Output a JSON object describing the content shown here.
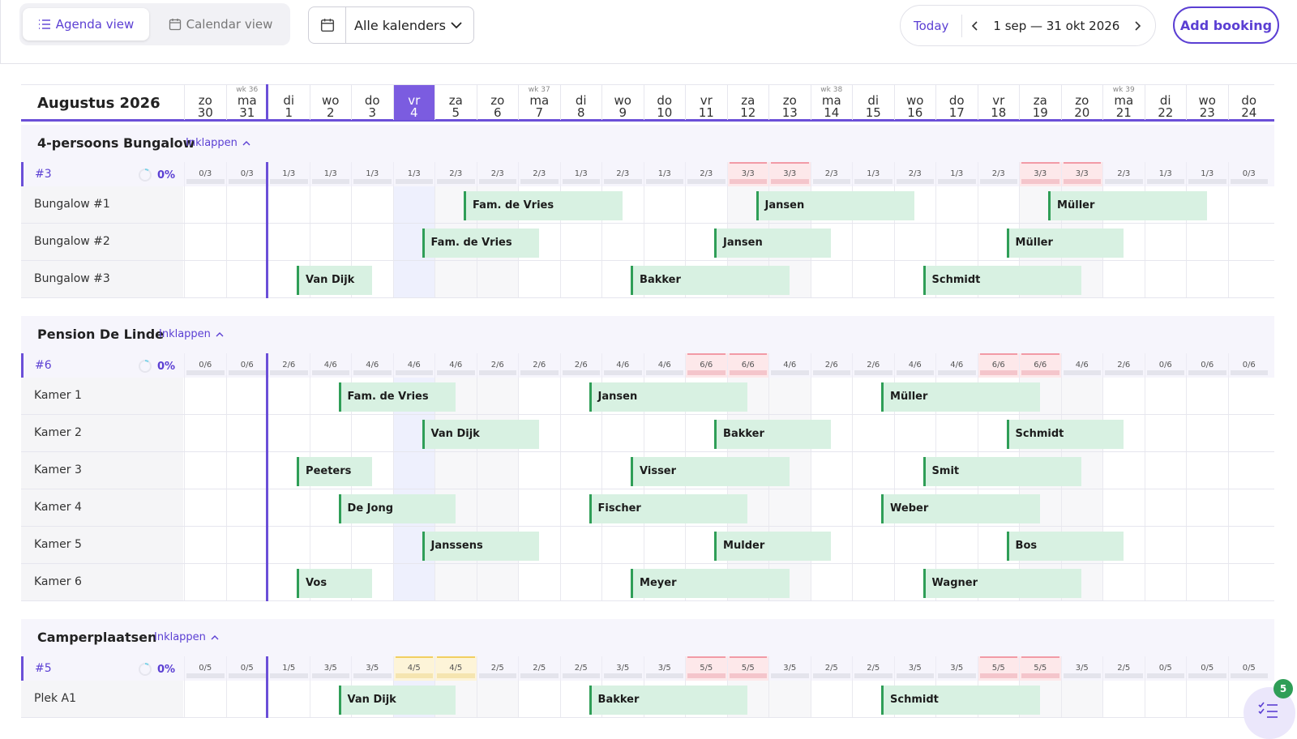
{
  "toolbar": {
    "agenda_label": "Agenda view",
    "calendar_label": "Calendar view",
    "calendar_select": "Alle kalenders",
    "today_label": "Today",
    "date_range": "1 sep — 31 okt 2026",
    "add_booking_label": "Add booking"
  },
  "header": {
    "month": "Augustus 2026",
    "today_index": 6,
    "days": [
      {
        "wk": "",
        "dn": "zo",
        "dd": "30"
      },
      {
        "wk": "wk 36",
        "dn": "ma",
        "dd": "31"
      },
      {
        "wk": "",
        "dn": "di",
        "dd": "1"
      },
      {
        "wk": "",
        "dn": "wo",
        "dd": "2"
      },
      {
        "wk": "",
        "dn": "do",
        "dd": "3"
      },
      {
        "wk": "",
        "dn": "vr",
        "dd": "4"
      },
      {
        "wk": "",
        "dn": "za",
        "dd": "5"
      },
      {
        "wk": "",
        "dn": "zo",
        "dd": "6"
      },
      {
        "wk": "wk 37",
        "dn": "ma",
        "dd": "7"
      },
      {
        "wk": "",
        "dn": "di",
        "dd": "8"
      },
      {
        "wk": "",
        "dn": "wo",
        "dd": "9"
      },
      {
        "wk": "",
        "dn": "do",
        "dd": "10"
      },
      {
        "wk": "",
        "dn": "vr",
        "dd": "11"
      },
      {
        "wk": "",
        "dn": "za",
        "dd": "12"
      },
      {
        "wk": "",
        "dn": "zo",
        "dd": "13"
      },
      {
        "wk": "wk 38",
        "dn": "ma",
        "dd": "14"
      },
      {
        "wk": "",
        "dn": "di",
        "dd": "15"
      },
      {
        "wk": "",
        "dn": "wo",
        "dd": "16"
      },
      {
        "wk": "",
        "dn": "do",
        "dd": "17"
      },
      {
        "wk": "",
        "dn": "vr",
        "dd": "18"
      },
      {
        "wk": "",
        "dn": "za",
        "dd": "19"
      },
      {
        "wk": "",
        "dn": "zo",
        "dd": "20"
      },
      {
        "wk": "wk 39",
        "dn": "ma",
        "dd": "21"
      },
      {
        "wk": "",
        "dn": "di",
        "dd": "22"
      },
      {
        "wk": "",
        "dn": "wo",
        "dd": "23"
      },
      {
        "wk": "",
        "dn": "do",
        "dd": "24"
      }
    ]
  },
  "collapse_label": "Inklappen",
  "sections": [
    {
      "title": "4-persoons Bungalow",
      "occ_id": "#3",
      "occ_pct": "0%",
      "occupancy": [
        "0/3",
        "0/3",
        "1/3",
        "1/3",
        "1/3",
        "1/3",
        "2/3",
        "2/3",
        "2/3",
        "1/3",
        "2/3",
        "1/3",
        "2/3",
        "3/3",
        "3/3",
        "2/3",
        "1/3",
        "2/3",
        "1/3",
        "2/3",
        "3/3",
        "3/3",
        "2/3",
        "1/3",
        "1/3",
        "0/3"
      ],
      "occ_status": [
        "",
        "",
        "",
        "",
        "",
        "",
        "",
        "",
        "",
        "",
        "",
        "",
        "",
        "full",
        "full",
        "",
        "",
        "",
        "",
        "",
        "full",
        "full",
        "",
        "",
        "",
        ""
      ],
      "units": [
        {
          "name": "Bungalow #1",
          "bookings": [
            {
              "label": "Fam. de Vries",
              "start": 6.7,
              "len": 3.8
            },
            {
              "label": "Jansen",
              "start": 13.7,
              "len": 3.8
            },
            {
              "label": "Müller",
              "start": 20.7,
              "len": 3.8
            }
          ]
        },
        {
          "name": "Bungalow #2",
          "bookings": [
            {
              "label": "Fam. de Vries",
              "start": 5.7,
              "len": 2.8
            },
            {
              "label": "Jansen",
              "start": 12.7,
              "len": 2.8
            },
            {
              "label": "Müller",
              "start": 19.7,
              "len": 2.8
            }
          ]
        },
        {
          "name": "Bungalow #3",
          "bookings": [
            {
              "label": "Van Dijk",
              "start": 2.7,
              "len": 1.8
            },
            {
              "label": "Bakker",
              "start": 10.7,
              "len": 3.8
            },
            {
              "label": "Schmidt",
              "start": 17.7,
              "len": 3.8
            }
          ]
        }
      ]
    },
    {
      "title": "Pension De Linde",
      "occ_id": "#6",
      "occ_pct": "0%",
      "occupancy": [
        "0/6",
        "0/6",
        "2/6",
        "4/6",
        "4/6",
        "4/6",
        "4/6",
        "2/6",
        "2/6",
        "2/6",
        "4/6",
        "4/6",
        "6/6",
        "6/6",
        "4/6",
        "2/6",
        "2/6",
        "4/6",
        "4/6",
        "6/6",
        "6/6",
        "4/6",
        "2/6",
        "0/6",
        "0/6",
        "0/6"
      ],
      "occ_status": [
        "",
        "",
        "",
        "",
        "",
        "",
        "",
        "",
        "",
        "",
        "",
        "",
        "full",
        "full",
        "",
        "",
        "",
        "",
        "",
        "full",
        "full",
        "",
        "",
        "",
        "",
        ""
      ],
      "units": [
        {
          "name": "Kamer 1",
          "bookings": [
            {
              "label": "Fam. de Vries",
              "start": 3.7,
              "len": 2.8
            },
            {
              "label": "Jansen",
              "start": 9.7,
              "len": 3.8
            },
            {
              "label": "Müller",
              "start": 16.7,
              "len": 3.8
            }
          ]
        },
        {
          "name": "Kamer 2",
          "bookings": [
            {
              "label": "Van Dijk",
              "start": 5.7,
              "len": 2.8
            },
            {
              "label": "Bakker",
              "start": 12.7,
              "len": 2.8
            },
            {
              "label": "Schmidt",
              "start": 19.7,
              "len": 2.8
            }
          ]
        },
        {
          "name": "Kamer 3",
          "bookings": [
            {
              "label": "Peeters",
              "start": 2.7,
              "len": 1.8
            },
            {
              "label": "Visser",
              "start": 10.7,
              "len": 3.8
            },
            {
              "label": "Smit",
              "start": 17.7,
              "len": 3.8
            }
          ]
        },
        {
          "name": "Kamer 4",
          "bookings": [
            {
              "label": "De Jong",
              "start": 3.7,
              "len": 2.8
            },
            {
              "label": "Fischer",
              "start": 9.7,
              "len": 3.8
            },
            {
              "label": "Weber",
              "start": 16.7,
              "len": 3.8
            }
          ]
        },
        {
          "name": "Kamer 5",
          "bookings": [
            {
              "label": "Janssens",
              "start": 5.7,
              "len": 2.8
            },
            {
              "label": "Mulder",
              "start": 12.7,
              "len": 2.8
            },
            {
              "label": "Bos",
              "start": 19.7,
              "len": 2.8
            }
          ]
        },
        {
          "name": "Kamer 6",
          "bookings": [
            {
              "label": "Vos",
              "start": 2.7,
              "len": 1.8
            },
            {
              "label": "Meyer",
              "start": 10.7,
              "len": 3.8
            },
            {
              "label": "Wagner",
              "start": 17.7,
              "len": 3.8
            }
          ]
        }
      ]
    },
    {
      "title": "Camperplaatsen",
      "occ_id": "#5",
      "occ_pct": "0%",
      "occupancy": [
        "0/5",
        "0/5",
        "1/5",
        "3/5",
        "3/5",
        "4/5",
        "4/5",
        "2/5",
        "2/5",
        "2/5",
        "3/5",
        "3/5",
        "5/5",
        "5/5",
        "3/5",
        "2/5",
        "2/5",
        "3/5",
        "3/5",
        "5/5",
        "5/5",
        "3/5",
        "2/5",
        "0/5",
        "0/5",
        "0/5"
      ],
      "occ_status": [
        "",
        "",
        "",
        "",
        "",
        "warn",
        "warn",
        "",
        "",
        "",
        "",
        "",
        "full",
        "full",
        "",
        "",
        "",
        "",
        "",
        "full",
        "full",
        "",
        "",
        "",
        "",
        ""
      ],
      "units": [
        {
          "name": "Plek A1",
          "bookings": [
            {
              "label": "Van Dijk",
              "start": 3.7,
              "len": 2.8
            },
            {
              "label": "Bakker",
              "start": 9.7,
              "len": 3.8
            },
            {
              "label": "Schmidt",
              "start": 16.7,
              "len": 3.8
            }
          ]
        }
      ]
    }
  ],
  "fab_badge": "5",
  "colors": {
    "accent": "#5b3fd3",
    "booking": "#d8f1e2",
    "booking_border": "#2f9e57",
    "full": "#fde8ea"
  }
}
